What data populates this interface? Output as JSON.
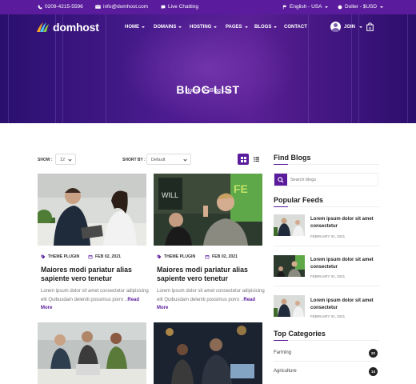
{
  "topbar": {
    "phone": "0209-4215-5596",
    "email": "info@domhost.com",
    "chat": "Live Chatting",
    "language": "English - USA",
    "currency": "Doller - $USD"
  },
  "nav": {
    "logo": "domhost",
    "items": [
      "HOME",
      "DOMAINS",
      "HOSTING",
      "PAGES",
      "BLOGS",
      "CONTACT"
    ],
    "join": "JOIN"
  },
  "hero": {
    "title": "BLOG LIST",
    "breadcrumb": [
      "Home",
      "Blog List"
    ]
  },
  "controls": {
    "show_label": "SHOW :",
    "show_value": "12",
    "sort_label": "SHORT BY :",
    "sort_value": "Default"
  },
  "posts": [
    {
      "category": "THEME PLUGIN",
      "date": "FEB 02, 2021",
      "title": "Maiores modi pariatur alias sapiente vero tenetur",
      "excerpt": "Lorem ipsum dolor sit amet consectetur adipisicing elit Quibusdam deleniti possimus porro ..",
      "read_more": "Read More"
    },
    {
      "category": "THEME PLUGIN",
      "date": "FEB 02, 2021",
      "title": "Maiores modi pariatur alias sapiente vero tenetur",
      "excerpt": "Lorem ipsum dolor sit amet consectetur adipisicing elit Quibusdam deleniti possimus porro ..",
      "read_more": "Read More"
    }
  ],
  "sidebar": {
    "find_title": "Find Blogs",
    "search_placeholder": "Search blogs",
    "popular_title": "Popular Feeds",
    "feeds": [
      {
        "title": "Lorem ipsum dolor sit amet consectetur",
        "date": "FEBRUARY 02, 2021"
      },
      {
        "title": "Lorem ipsum dolor sit amet consectetur",
        "date": "FEBRUARY 02, 2021"
      },
      {
        "title": "Lorem ipsum dolor sit amet consectetur",
        "date": "FEBRUARY 02, 2021"
      }
    ],
    "categories_title": "Top Categories",
    "categories": [
      {
        "name": "Farming",
        "count": "22"
      },
      {
        "name": "Agriculture",
        "count": "14"
      }
    ]
  },
  "colors": {
    "accent": "#5a1c9c",
    "topbar": "#5a1c9c",
    "dark": "#1d1d1d"
  }
}
